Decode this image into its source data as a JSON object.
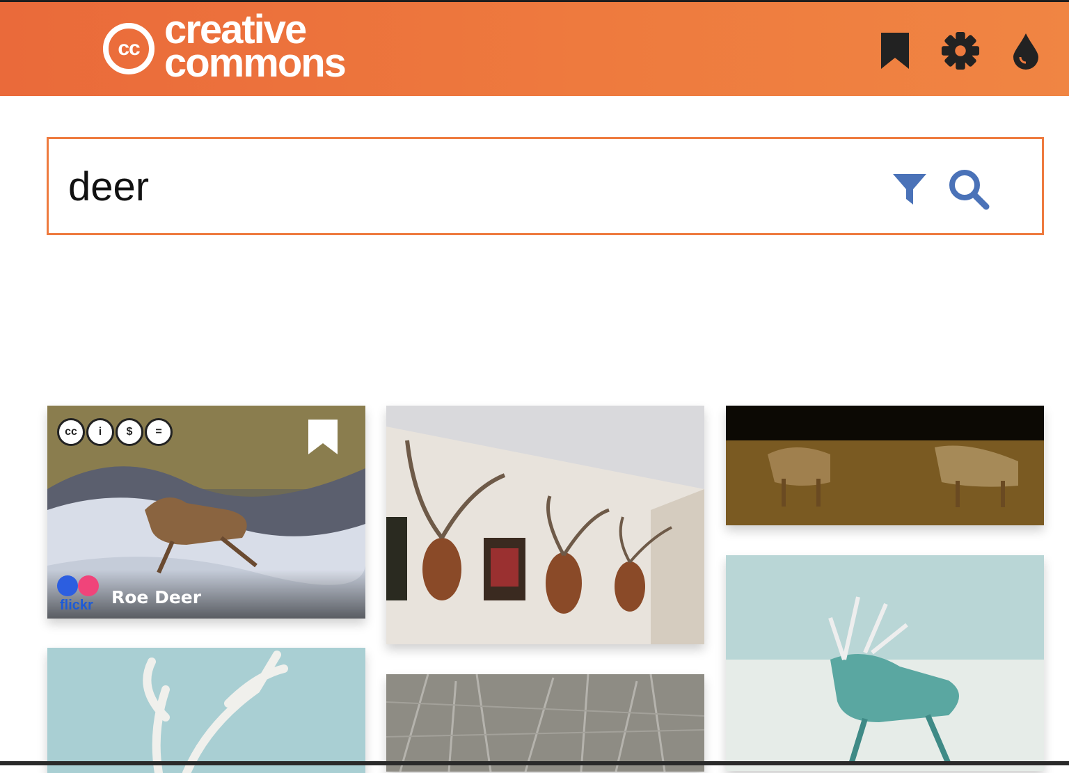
{
  "header": {
    "logo_cc": "cc",
    "logo_line1": "creative",
    "logo_line2": "commons",
    "icons": [
      "bookmark-icon",
      "gear-icon",
      "droplet-icon"
    ],
    "brand_color": "#ee7a3e"
  },
  "search": {
    "value": "deer",
    "filter_icon": "filter-icon",
    "search_icon": "search-icon",
    "icon_color": "#4a72b8"
  },
  "results": [
    {
      "title": "Roe Deer",
      "source": "flickr",
      "license_icons": [
        "cc",
        "by",
        "nc",
        "nd"
      ],
      "license_glyphs": [
        "cc",
        "i",
        "$",
        "="
      ]
    }
  ]
}
